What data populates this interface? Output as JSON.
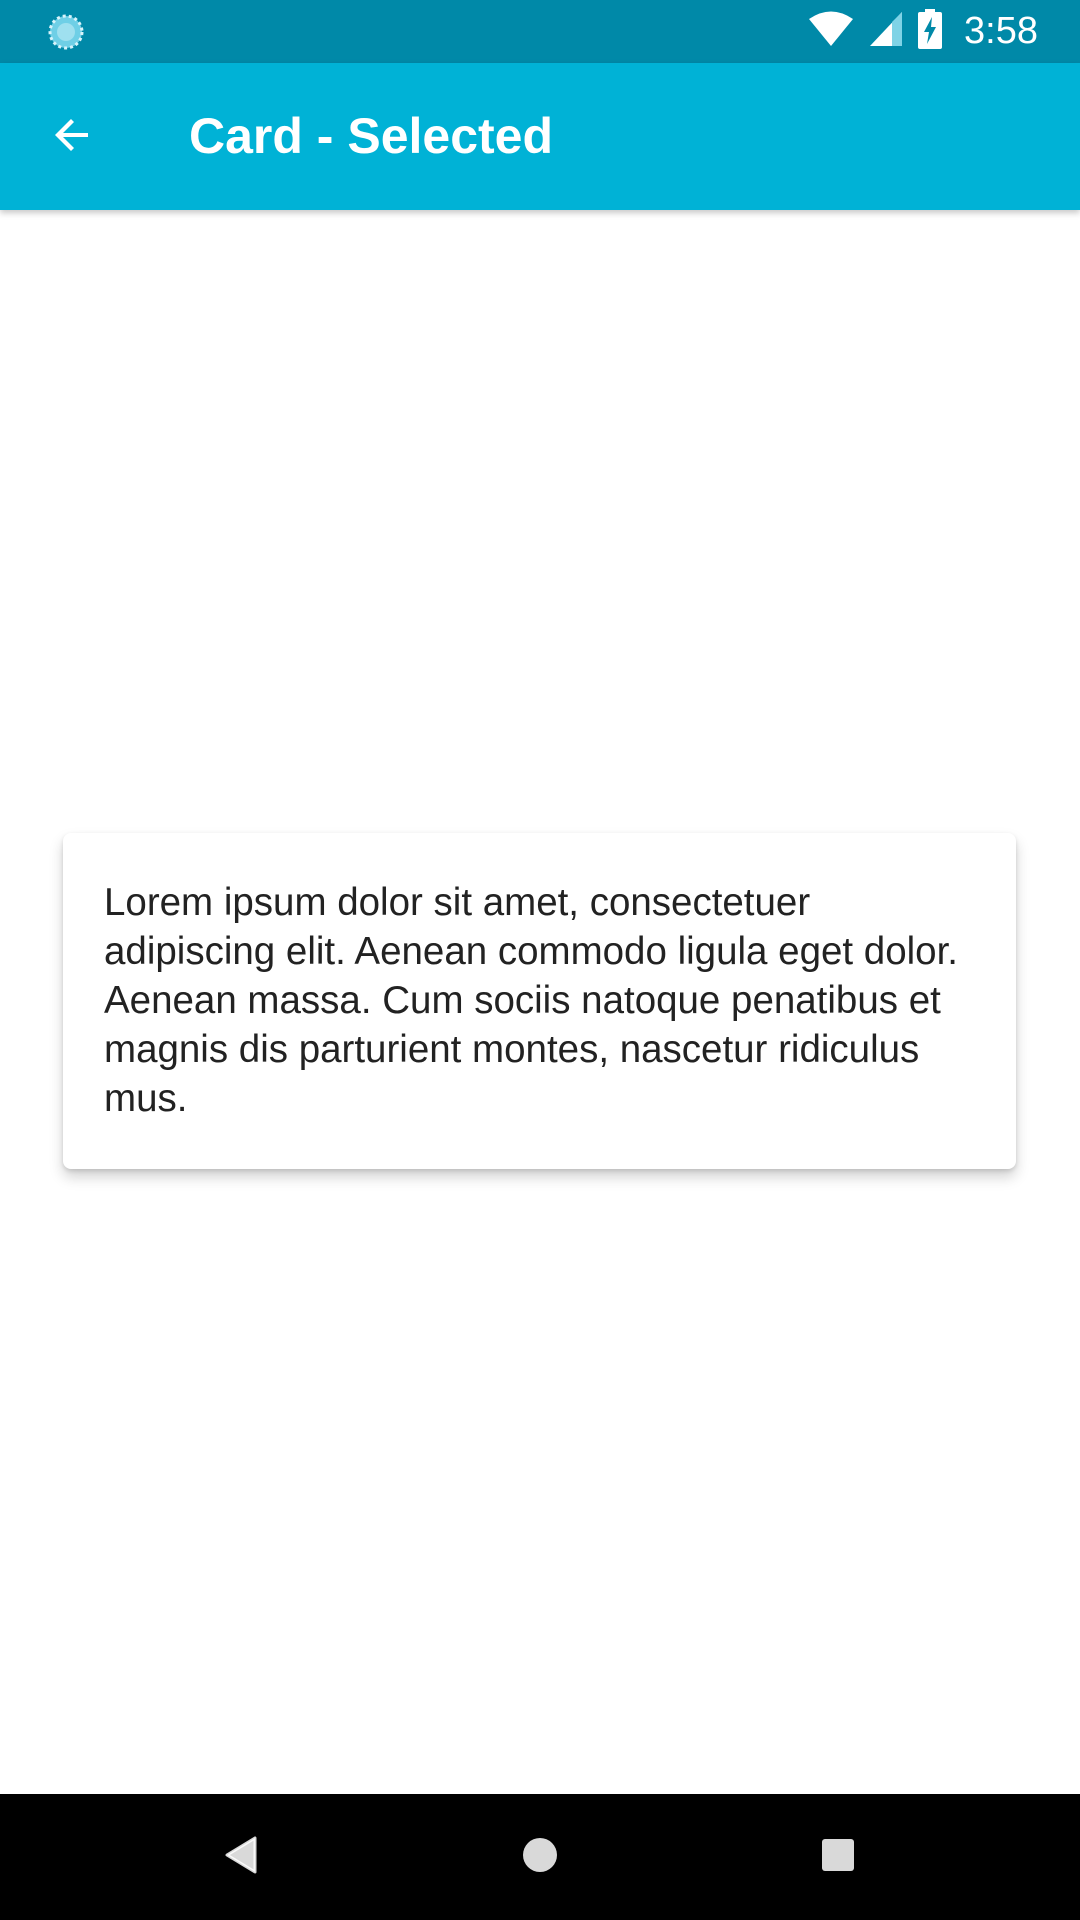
{
  "status_bar": {
    "time": "3:58",
    "left_icon": "sync-notification-icon",
    "icons": [
      "wifi-icon",
      "cell-signal-icon",
      "battery-charging-icon"
    ],
    "color": "#0089a8"
  },
  "app_bar": {
    "title": "Card - Selected",
    "back_icon": "arrow-back-icon",
    "color": "#00b2d6"
  },
  "card": {
    "text": "Lorem ipsum dolor sit amet, consectetuer adipiscing elit. Aenean commodo ligula eget dolor. Aenean massa. Cum sociis natoque penatibus et magnis dis parturient montes, nascetur ridiculus mus."
  },
  "nav_bar": {
    "buttons": [
      "back-triangle-icon",
      "home-circle-icon",
      "recents-square-icon"
    ]
  }
}
